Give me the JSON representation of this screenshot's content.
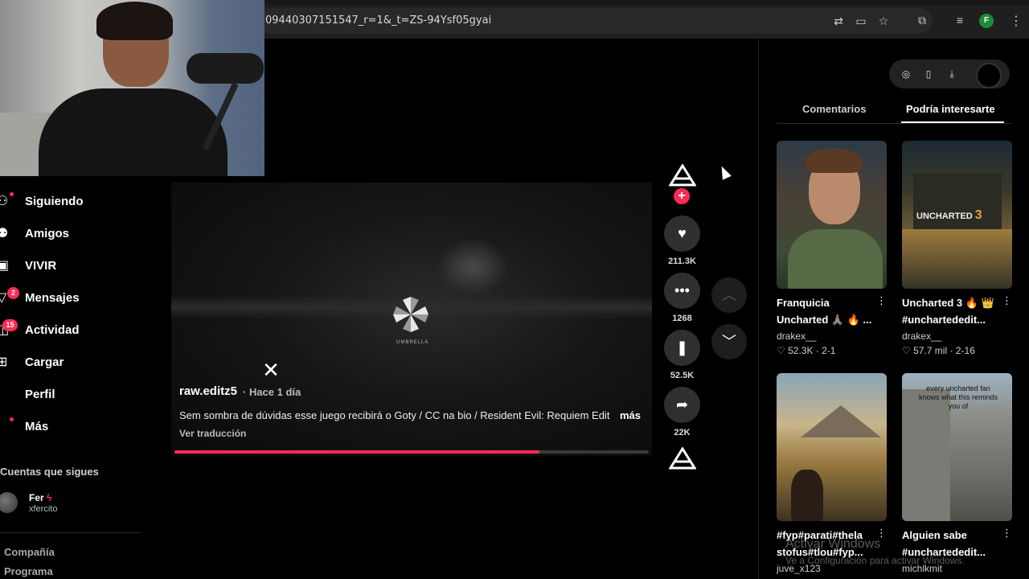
{
  "browser": {
    "url": "09440307151547_r=1&_t=ZS-94Ysf05gyai",
    "profile_initial": "F",
    "icons": [
      "translate-icon",
      "cast-icon",
      "star-icon",
      "extensions-icon",
      "media-icon",
      "profile-icon",
      "menu-icon"
    ]
  },
  "sidebar": {
    "items": [
      {
        "label": "Siguiendo",
        "icon": "following-icon"
      },
      {
        "label": "Amigos",
        "icon": "friends-icon"
      },
      {
        "label": "VIVIR",
        "icon": "live-icon"
      },
      {
        "label": "Mensajes",
        "icon": "messages-icon",
        "badge": "2"
      },
      {
        "label": "Actividad",
        "icon": "activity-icon",
        "badge": "15"
      },
      {
        "label": "Cargar",
        "icon": "upload-icon"
      },
      {
        "label": "Perfil",
        "icon": "profile-icon"
      },
      {
        "label": "Más",
        "icon": "more-icon"
      }
    ],
    "following_title": "Cuentas que sigues",
    "account": {
      "name": "Fer",
      "handle": "xfercito"
    },
    "footer": [
      "Compañía",
      "Programa"
    ]
  },
  "video": {
    "logo_text": "UMBRELLA",
    "author": "raw.editz5",
    "posted": "· Hace 1 día",
    "caption": "Sem sombra de dúvidas esse juego recibirá o Goty / CC na bio / Resident Evil: Requiem Edit",
    "more": "más",
    "translate": "Ver traducción",
    "progress": 0.77
  },
  "actions": {
    "likes": "211.3K",
    "comments": "1268",
    "saves": "52.5K",
    "shares": "22K"
  },
  "right_panel": {
    "tabs": [
      "Comentarios",
      "Podría interesarte"
    ],
    "active_tab": 1,
    "videos": [
      {
        "title": "Franquicia Uncharted 🙏🏽 🔥 ...",
        "user": "drakex__",
        "likes": "52.3K",
        "date": "2-1"
      },
      {
        "title": "Uncharted 3 🔥 👑 #unchartededit...",
        "user": "drakex__",
        "likes": "57.7 mil",
        "date": "2-16"
      },
      {
        "title": "#fyp#parati#thela stofus#tlou#fyp...",
        "user": "juve_x123",
        "likes": "",
        "date": ""
      },
      {
        "title": "Alguien sabe #unchartededit...",
        "user": "michlkmit",
        "likes": "",
        "date": ""
      }
    ],
    "thumb_overlay_text": "every uncharted fan knows what this reminds you of"
  },
  "watermark": {
    "line1": "Activar Windows",
    "line2": "Ve a Configuración para activar Windows."
  },
  "colors": {
    "accent": "#fe2c55",
    "background": "#000000"
  }
}
